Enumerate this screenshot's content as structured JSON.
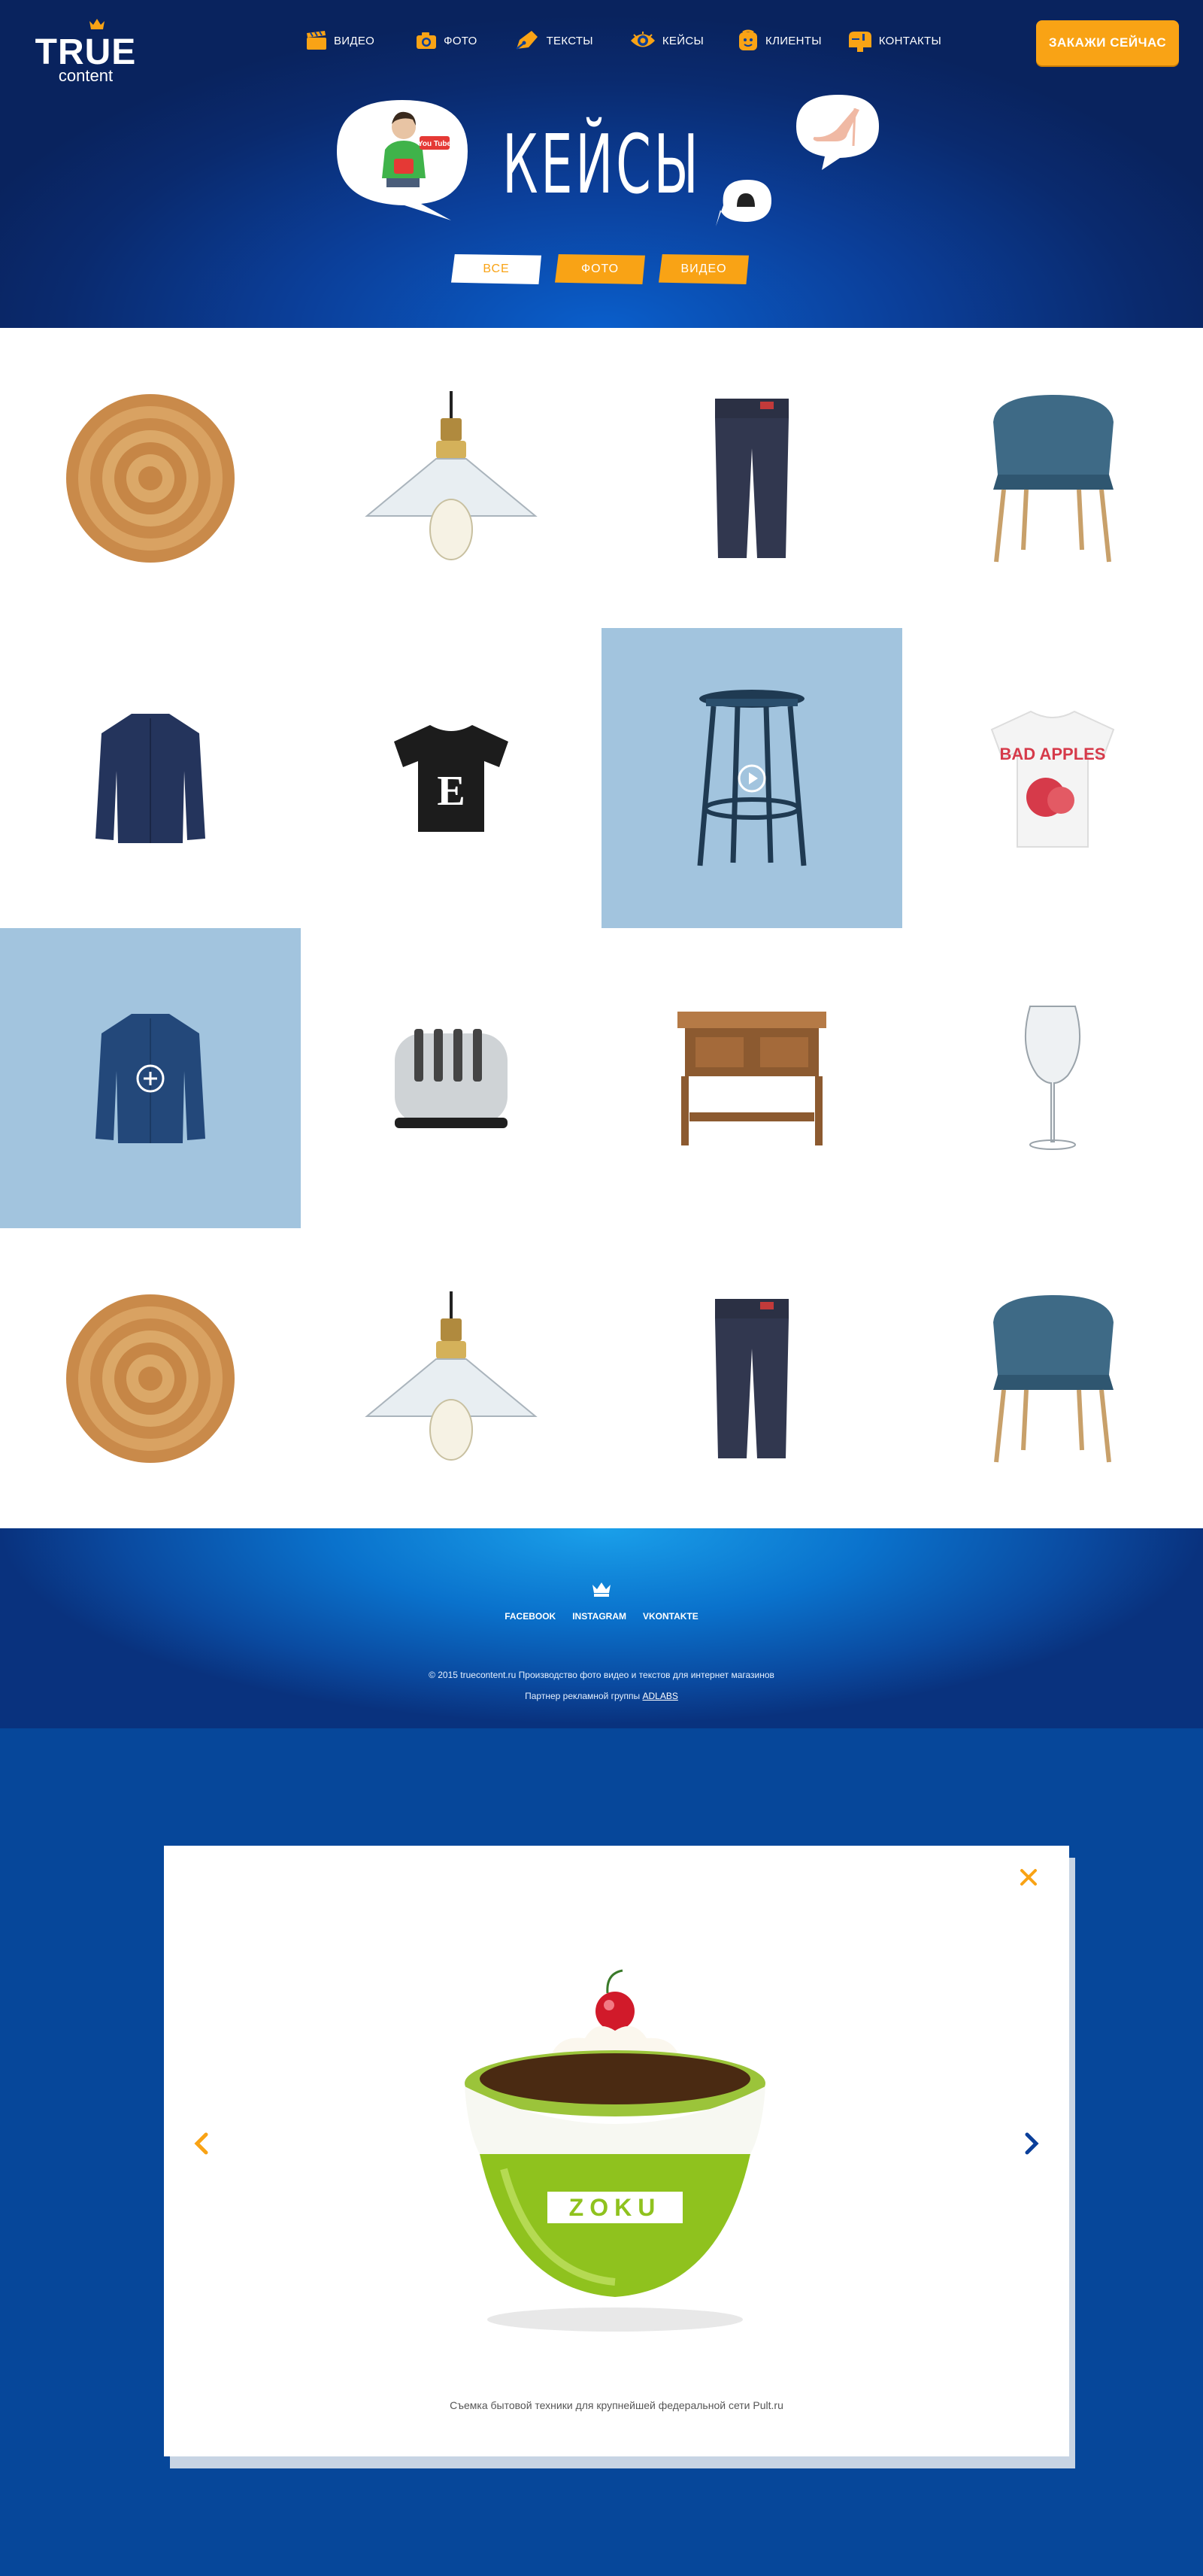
{
  "brand": {
    "logo_main": "TRUE",
    "logo_sub": "content"
  },
  "nav": [
    {
      "label": "ВИДЕО",
      "icon": "clapperboard-icon"
    },
    {
      "label": "ФОТО",
      "icon": "camera-icon"
    },
    {
      "label": "ТЕКСТЫ",
      "icon": "pen-icon"
    },
    {
      "label": "КЕЙСЫ",
      "icon": "eye-icon"
    },
    {
      "label": "КЛИЕНТЫ",
      "icon": "face-icon"
    },
    {
      "label": "КОНТАКТЫ",
      "icon": "mailbox-icon"
    }
  ],
  "cta": {
    "label": "ЗАКАЖИ СЕЙЧАС"
  },
  "hero": {
    "title": "КЕЙСЫ",
    "youtube_label": "You Tube"
  },
  "filters": [
    {
      "label": "ВСЕ",
      "active": true
    },
    {
      "label": "ФОТО",
      "active": false
    },
    {
      "label": "ВИДЕО",
      "active": false
    }
  ],
  "grid": {
    "items": [
      "wicker-plate",
      "edison-lamp",
      "jeans",
      "wicker-chair",
      "denim-jacket",
      "black-tshirt",
      "bar-stool",
      "bad-apples-tshirt",
      "denim-jacket",
      "toaster",
      "kitchen-island",
      "wine-glass",
      "wicker-plate",
      "edison-lamp",
      "jeans",
      "wicker-chair"
    ],
    "tshirt_letter": "E",
    "bad_apples_text": "BAD APPLES"
  },
  "footer": {
    "social": [
      "FACEBOOK",
      "INSTAGRAM",
      "VKONTAKTE"
    ],
    "copyright": "© 2015 truecontent.ru  Производство фото видео и текстов для интернет магазинов",
    "partner_prefix": "Партнер  рекламной группы ",
    "partner_link": "ADLABS"
  },
  "modal": {
    "product_brand": "ZOKU",
    "caption": "Съемка бытовой техники для крупнейшей федеральной сети Pult.ru"
  },
  "colors": {
    "accent": "#f9a315",
    "navy": "#0b3f9a",
    "highlight": "#a2c4de"
  }
}
